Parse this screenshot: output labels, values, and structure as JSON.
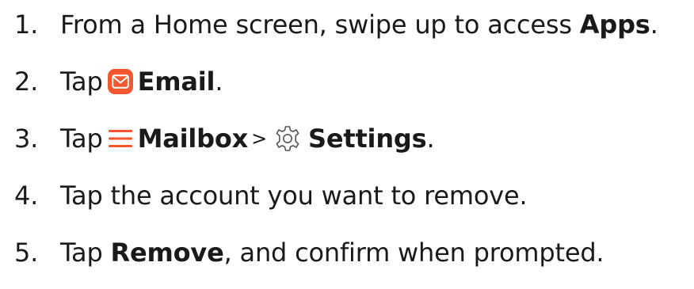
{
  "steps": [
    {
      "number": "1.",
      "text_before": "From a Home screen, swipe up to access ",
      "bold": "Apps",
      "text_after": "."
    },
    {
      "number": "2.",
      "verb": "Tap",
      "icon": "email-app-icon",
      "bold": "Email",
      "text_after": "."
    },
    {
      "number": "3.",
      "verb": "Tap",
      "icon_1": "hamburger-menu-icon",
      "bold_1": "Mailbox",
      "separator": ">",
      "icon_2": "settings-gear-icon",
      "bold_2": "Settings",
      "text_after": "."
    },
    {
      "number": "4.",
      "text": "Tap the account you want to remove."
    },
    {
      "number": "5.",
      "verb": "Tap ",
      "bold": "Remove",
      "text_after": ", and confirm when prompted."
    }
  ],
  "colors": {
    "text": "#1a1a1a",
    "email_icon_bg": "#f2572f",
    "menu_icon": "#f2572f",
    "gear_icon": "#555555"
  }
}
